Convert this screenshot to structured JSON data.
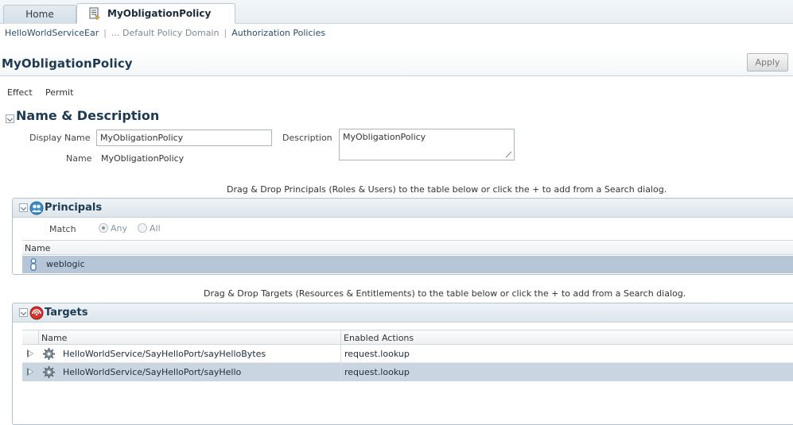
{
  "tabs": {
    "home": "Home",
    "active": "MyObligationPolicy"
  },
  "breadcrumb": {
    "item1": "HelloWorldServiceEar",
    "item2": "... Default Policy Domain",
    "item3": "Authorization Policies"
  },
  "page": {
    "title": "MyObligationPolicy",
    "apply": "Apply"
  },
  "effect": {
    "label": "Effect",
    "value": "Permit"
  },
  "name_desc": {
    "title": "Name & Description",
    "display_name_label": "Display Name",
    "display_name_value": "MyObligationPolicy",
    "description_label": "Description",
    "description_value": "MyObligationPolicy",
    "name_label": "Name",
    "name_value": "MyObligationPolicy"
  },
  "principals": {
    "hint": "Drag & Drop Principals (Roles & Users) to the table below or click the + to add from a Search dialog.",
    "title": "Principals",
    "match_label": "Match",
    "any": "Any",
    "all": "All",
    "selected": "Any",
    "column": "Name",
    "rows": [
      {
        "name": "weblogic",
        "icon": "user-icon"
      }
    ]
  },
  "targets": {
    "hint": "Drag & Drop Targets (Resources & Entitlements) to the table below or click the + to add from a Search dialog.",
    "title": "Targets",
    "columns": [
      "Name",
      "Enabled Actions"
    ],
    "rows": [
      {
        "name": "HelloWorldService/SayHelloPort/sayHelloBytes",
        "actions": "request.lookup",
        "icon": "gear-icon"
      },
      {
        "name": "HelloWorldService/SayHelloPort/sayHello",
        "actions": "request.lookup",
        "icon": "gear-icon"
      }
    ]
  },
  "colors": {
    "accent": "#1e3a52",
    "selected_row": "#b6c6d7",
    "targets_icon": "#d9302c"
  }
}
